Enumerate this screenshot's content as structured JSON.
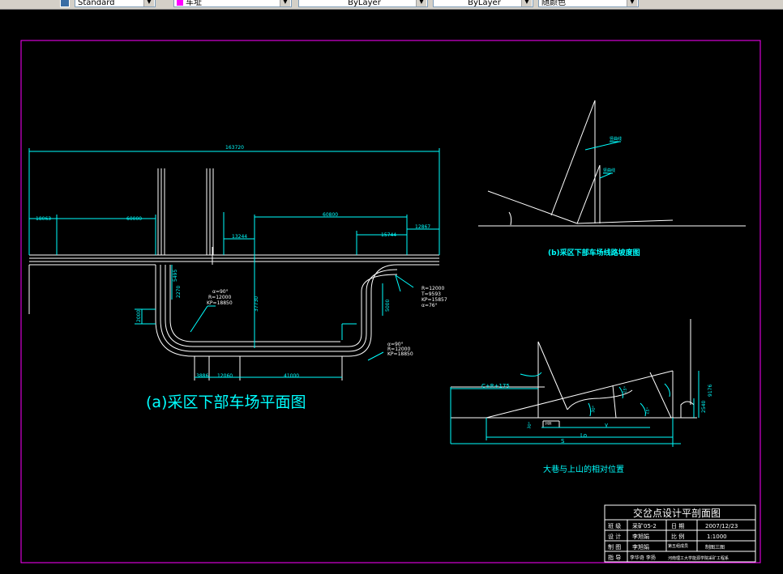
{
  "toolbar": {
    "style_value": "Standard",
    "layer_value": "车址",
    "color_value": "ByLayer",
    "linetype_value": "ByLayer",
    "lineweight_value": "随颜色"
  },
  "drawing_a": {
    "title": "(a)采区下部车场平面图",
    "dim_total": "163720",
    "dim_left": "18063",
    "dim_60000": "60000",
    "dim_13244": "13244",
    "dim_60800": "60800",
    "dim_15744": "15744",
    "dim_right": "12867",
    "dim_37730": "37730",
    "dim_5495": "5495",
    "dim_2270": "2270",
    "dim_2000": "2000",
    "dim_5000_v": "5000",
    "dim_3886": "3886",
    "dim_12060": "12060",
    "dim_41000": "41000",
    "curve_left": [
      "α=90°",
      "R=12000",
      "KP=18850"
    ],
    "curve_right_top": [
      "R=12000",
      "T=9593",
      "KP=15857",
      "α=76°"
    ],
    "curve_right_bottom": [
      "α=90°",
      "R=12000",
      "KP=18850"
    ]
  },
  "drawing_b": {
    "title": "(b)采区下部车场线路坡度图",
    "label_upper": "竖曲线",
    "label_lower": "竖曲线"
  },
  "drawing_c": {
    "title": "大巷与上山的相对位置",
    "label_ctr": "C+R+175",
    "label_y": "y",
    "label_lo": "Lo",
    "label_s": "S",
    "label_hh": "HH",
    "label_9176": "9176",
    "label_2540": "2540",
    "label_angle1": "30°",
    "label_angle2": "30°",
    "label_angle3": "15°",
    "label_angle4": "15°"
  },
  "title_block": {
    "heading": "交岔点设计平剖面图",
    "rows": [
      [
        "班 级",
        "采矿05-2",
        "日 期",
        "2007/12/23"
      ],
      [
        "设 计",
        "李旭娟",
        "比 例",
        "1:1000"
      ],
      [
        "制 图",
        "李旭娟",
        "第五组成员",
        "制图三图"
      ],
      [
        "指 导",
        "李华奇 李扬",
        "河南理工大学能源学院采矿工程系",
        ""
      ]
    ]
  }
}
